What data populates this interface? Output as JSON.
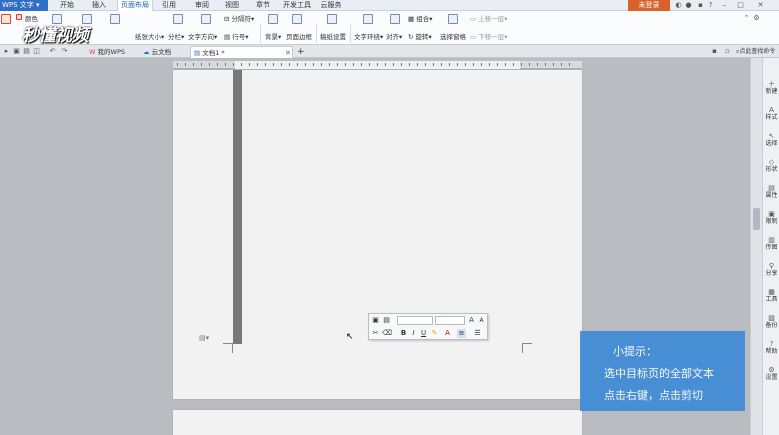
{
  "app": {
    "title": "WPS 文字"
  },
  "menu": {
    "tabs": [
      "开始",
      "插入",
      "页面布局",
      "引用",
      "审阅",
      "视图",
      "章节",
      "开发工具",
      "云服务"
    ],
    "active": "页面布局",
    "login": "未登录"
  },
  "ribbon": {
    "color": "颜色",
    "paper_size": "纸张大小",
    "columns": "分栏",
    "text_direction": "文字方向",
    "separator": "分隔符",
    "line_number": "行号",
    "background": "背景",
    "page_border": "页面边框",
    "draft_settings": "稿纸设置",
    "text_wrap": "文字环绕",
    "align": "对齐",
    "rotate": "旋转",
    "group": "组合",
    "selection_pane": "选择窗格",
    "bring_forward": "上移一层",
    "send_backward": "下移一层"
  },
  "watermark": "秒懂视频",
  "doc_tabs": {
    "my_wps": "我的WPS",
    "cloud_doc": "云文档",
    "doc1": "文档1 *",
    "add": "+"
  },
  "search": {
    "label": "点此查找命令"
  },
  "tip": {
    "title": "小提示：",
    "line1": "选中目标页的全部文本",
    "line2": "点击右键，点击剪切"
  },
  "sidebar": {
    "items": [
      {
        "label": "新建",
        "icon": "new-icon"
      },
      {
        "label": "样式",
        "icon": "style-icon"
      },
      {
        "label": "选择",
        "icon": "select-icon"
      },
      {
        "label": "形状",
        "icon": "shape-icon"
      },
      {
        "label": "属性",
        "icon": "property-icon"
      },
      {
        "label": "限制",
        "icon": "restrict-icon"
      },
      {
        "label": "传图",
        "icon": "upload-image-icon"
      },
      {
        "label": "分享",
        "icon": "share-icon"
      },
      {
        "label": "工具",
        "icon": "tools-icon"
      },
      {
        "label": "备份",
        "icon": "backup-icon"
      },
      {
        "label": "帮助",
        "icon": "help-icon"
      },
      {
        "label": "设置",
        "icon": "settings-icon"
      }
    ]
  },
  "colors": {
    "accent": "#2f6fc9",
    "login": "#d9622b",
    "tip_bg": "#3f8bd6",
    "selection": "#787878"
  }
}
